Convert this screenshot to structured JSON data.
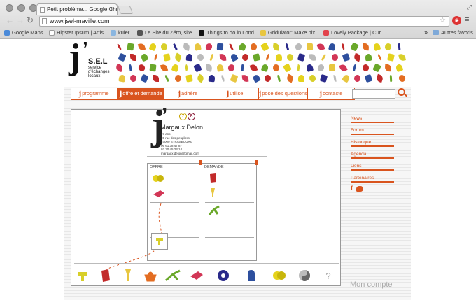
{
  "browser": {
    "tab_title": "Petit problème... Google Chr",
    "url": "www.jsel-maville.com",
    "bookmarks": [
      {
        "label": "Google Maps",
        "color": "#4a8ad9"
      },
      {
        "label": "Hipster Ipsum | Artis",
        "color": "#ffffff"
      },
      {
        "label": "kuler",
        "color": "#8ab6e0"
      },
      {
        "label": "Le Site du Zéro, site",
        "color": "#555555"
      },
      {
        "label": "Things to do in Lond",
        "color": "#111111"
      },
      {
        "label": "Gridulator: Make pix",
        "color": "#e8c640"
      },
      {
        "label": "Lovely Package | Cur",
        "color": "#e2434c"
      }
    ],
    "bookmarks_more": "»",
    "other_bookmarks": "Autres favoris"
  },
  "site": {
    "logo_letter": "j",
    "logo_apostrophe": "’",
    "logo_name": "S.E.L",
    "logo_tagline": "service d'échanges locaux",
    "nav": [
      {
        "label": "programme",
        "active": false
      },
      {
        "label": "offre et demande",
        "active": true
      },
      {
        "label": "adhère",
        "active": false
      },
      {
        "label": "utilise",
        "active": false
      },
      {
        "label": "pose des questions",
        "active": false
      },
      {
        "label": "contacte",
        "active": false
      }
    ],
    "nav_prefix": "j",
    "search_placeholder": ""
  },
  "profile": {
    "badge_offers": "7",
    "badge_demands": "8",
    "name": "Margaux Delon",
    "info_lines": [
      "27 ans",
      "35 rue des peupliers",
      "67000 STRASBOURG",
      "06 61 38 47 87",
      "03 20 45 23 14",
      "margaux.delon@gmail.com"
    ],
    "offer_label": "OFFRE",
    "demand_label": "DEMANDE"
  },
  "sidebar": {
    "links": [
      "News",
      "Forum",
      "Historique",
      "Agenda",
      "Liens",
      "Partenaires"
    ]
  },
  "account_label": "Mon compte",
  "help_label": "?",
  "colors": {
    "accent": "#d9541e"
  }
}
